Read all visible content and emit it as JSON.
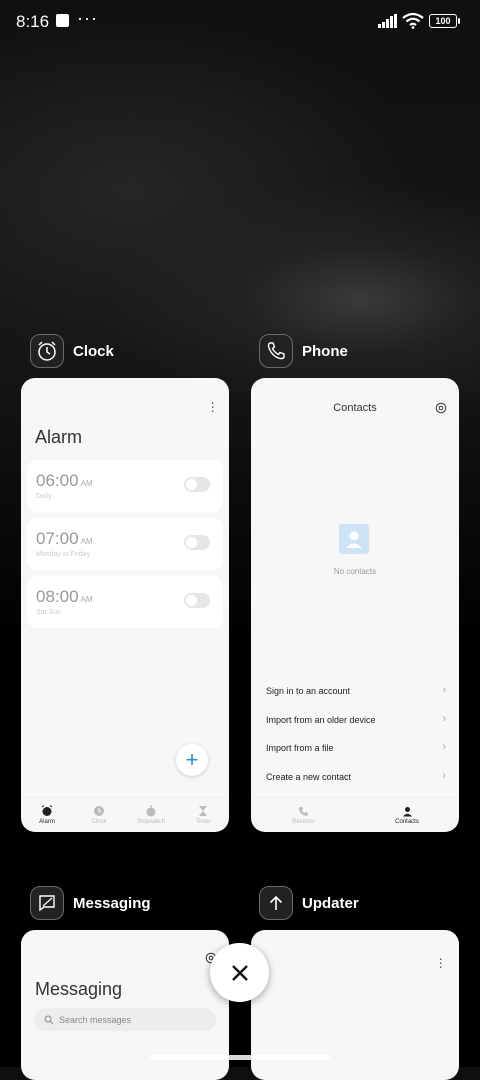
{
  "status_bar": {
    "time": "8:16",
    "dots": "···",
    "battery": "100"
  },
  "apps": {
    "clock": {
      "name": "Clock",
      "title": "Alarm",
      "alarms": [
        {
          "time": "06:00",
          "ampm": "AM",
          "repeat": "Daily"
        },
        {
          "time": "07:00",
          "ampm": "AM",
          "repeat": "Monday to Friday"
        },
        {
          "time": "08:00",
          "ampm": "AM",
          "repeat": "Sat Sun"
        }
      ],
      "nav": [
        "Alarm",
        "Clock",
        "Stopwatch",
        "Timer"
      ]
    },
    "phone": {
      "name": "Phone",
      "title": "Contacts",
      "empty_text": "No contacts",
      "actions": [
        "Sign in to an account",
        "Import from an older device",
        "Import from a file",
        "Create a new contact"
      ],
      "nav": [
        "Recents",
        "Contacts"
      ]
    },
    "messaging": {
      "name": "Messaging",
      "title": "Messaging",
      "search_placeholder": "Search messages"
    },
    "updater": {
      "name": "Updater"
    }
  },
  "colors": {
    "accent": "#2e8bd8"
  }
}
